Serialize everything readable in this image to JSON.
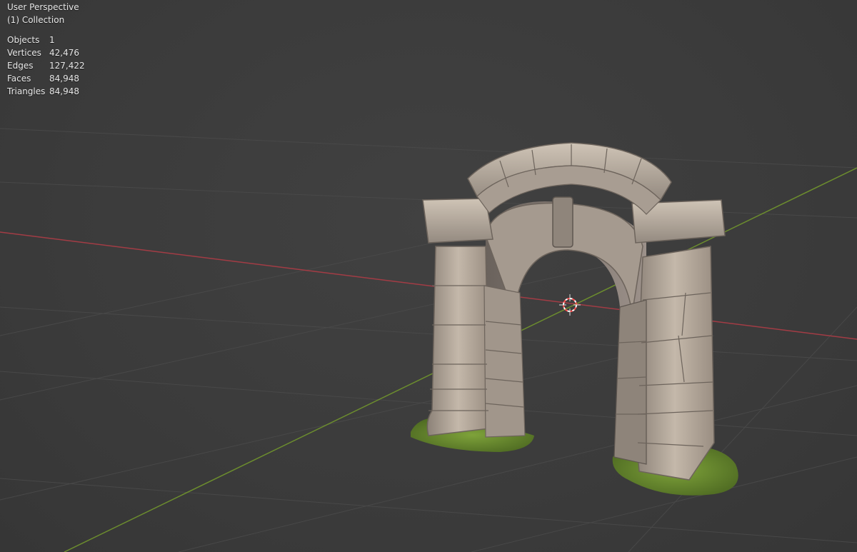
{
  "viewport": {
    "view_name": "User Perspective",
    "collection": "(1) Collection"
  },
  "statistics": [
    {
      "label": "Objects",
      "value": "1"
    },
    {
      "label": "Vertices",
      "value": "42,476"
    },
    {
      "label": "Edges",
      "value": "127,422"
    },
    {
      "label": "Faces",
      "value": "84,948"
    },
    {
      "label": "Triangles",
      "value": "84,948"
    }
  ],
  "colors": {
    "background": "#3d3d3d",
    "grid_line": "#484848",
    "x_axis": "#a33c45",
    "y_axis": "#6c8d2e",
    "stone": "#a89a8c",
    "moss": "#6a8a2a",
    "cursor": "#ff5555"
  },
  "scene_object": {
    "name": "stone-arch",
    "icon": "3d-cursor-icon"
  }
}
